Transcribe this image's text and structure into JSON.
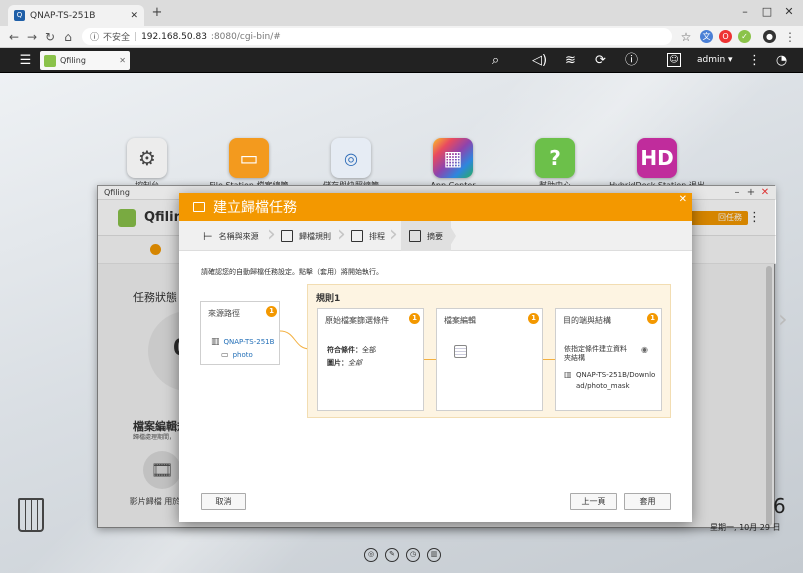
{
  "browser": {
    "tab_title": "QNAP-TS-251B",
    "new_tab": "+",
    "url_insecure": "不安全",
    "url_host": "192.168.50.83",
    "url_path": ":8080/cgi-bin/#"
  },
  "qts_bar": {
    "app_tab": "Qfiling",
    "user": "admin ▾"
  },
  "desktop_icons": [
    {
      "label": "控制台",
      "icon": "gear-icon",
      "color": "#e8e8e8"
    },
    {
      "label": "File Station 檔案總管",
      "icon": "folder-icon",
      "color": "#f39a1e"
    },
    {
      "label": "儲存與快照總管",
      "icon": "storage-icon",
      "color": "#dfe7f2"
    },
    {
      "label": "App Center",
      "icon": "grid-icon",
      "color": "#e84a5f"
    },
    {
      "label": "幫助中心",
      "icon": "help-icon",
      "color": "#6cc04a"
    },
    {
      "label": "HybridDesk Station 退出",
      "icon": "hd-icon",
      "color": "#c02c9c"
    }
  ],
  "qfiling_window": {
    "title": "Qfiling",
    "app_name": "Qfiling",
    "orange_button": "回任務",
    "task_status": "任務狀態",
    "task_count": "0",
    "edit_section": "檔案編輯規",
    "edit_sub": "歸檔處理期間，",
    "video_label": "影片歸檔 用於影片"
  },
  "clock": {
    "digit": "6",
    "date": "星期一, 10月 29 日"
  },
  "dialog": {
    "title": "建立歸檔任務",
    "steps": [
      {
        "label": "名稱與來源"
      },
      {
        "label": "歸檔規則"
      },
      {
        "label": "排程"
      },
      {
        "label": "摘要"
      }
    ],
    "instruction": "請確認您的自動歸檔任務設定。點擊（套用）將開始執行。",
    "source": {
      "title": "來源路徑",
      "badge": "1",
      "nas": "QNAP-TS-251B",
      "folder": "photo"
    },
    "rule": {
      "title": "規則1",
      "filter": {
        "title": "原始檔案篩選條件",
        "badge": "1",
        "line1_label": "符合條件：",
        "line1_value": "全部",
        "line2_label": "圖片：",
        "line2_value": "全部"
      },
      "edit": {
        "title": "檔案編輯",
        "badge": "1"
      },
      "target": {
        "title": "目的端與結構",
        "badge": "1",
        "desc": "依指定條件建立資料夾結構",
        "path": "QNAP-TS-251B/Download/photo_mask"
      }
    },
    "buttons": {
      "cancel": "取消",
      "prev": "上一頁",
      "apply": "套用"
    }
  }
}
